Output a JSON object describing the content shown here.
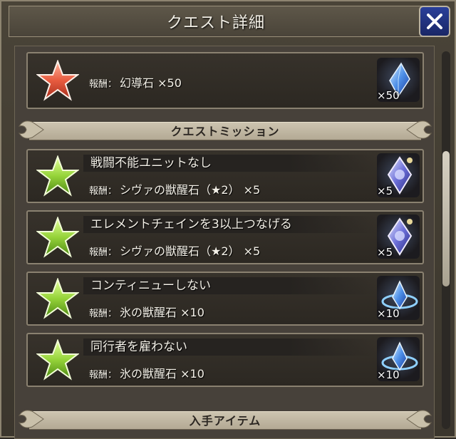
{
  "header": {
    "title": "クエスト詳細"
  },
  "clear_reward": {
    "label": "報酬：",
    "text": "幻導石 ×50",
    "item_count": "×50"
  },
  "mission_section": {
    "title": "クエストミッション"
  },
  "missions": [
    {
      "title": "戦闘不能ユニットなし",
      "label": "報酬：",
      "reward": "シヴァの獣醒石（★2） ×5",
      "item_count": "×5",
      "icon": "shiva-crystal-icon"
    },
    {
      "title": "エレメントチェインを3以上つなげる",
      "label": "報酬：",
      "reward": "シヴァの獣醒石（★2） ×5",
      "item_count": "×5",
      "icon": "shiva-crystal-icon"
    },
    {
      "title": "コンティニューしない",
      "label": "報酬：",
      "reward": "氷の獣醒石 ×10",
      "item_count": "×10",
      "icon": "ice-crystal-icon"
    },
    {
      "title": "同行者を雇わない",
      "label": "報酬：",
      "reward": "氷の獣醒石 ×10",
      "item_count": "×10",
      "icon": "ice-crystal-icon"
    }
  ],
  "items_section": {
    "title": "入手アイテム"
  },
  "colors": {
    "star_red": "#e0583c",
    "star_green": "#8ccc32",
    "close_blue": "#2a3f9a"
  }
}
